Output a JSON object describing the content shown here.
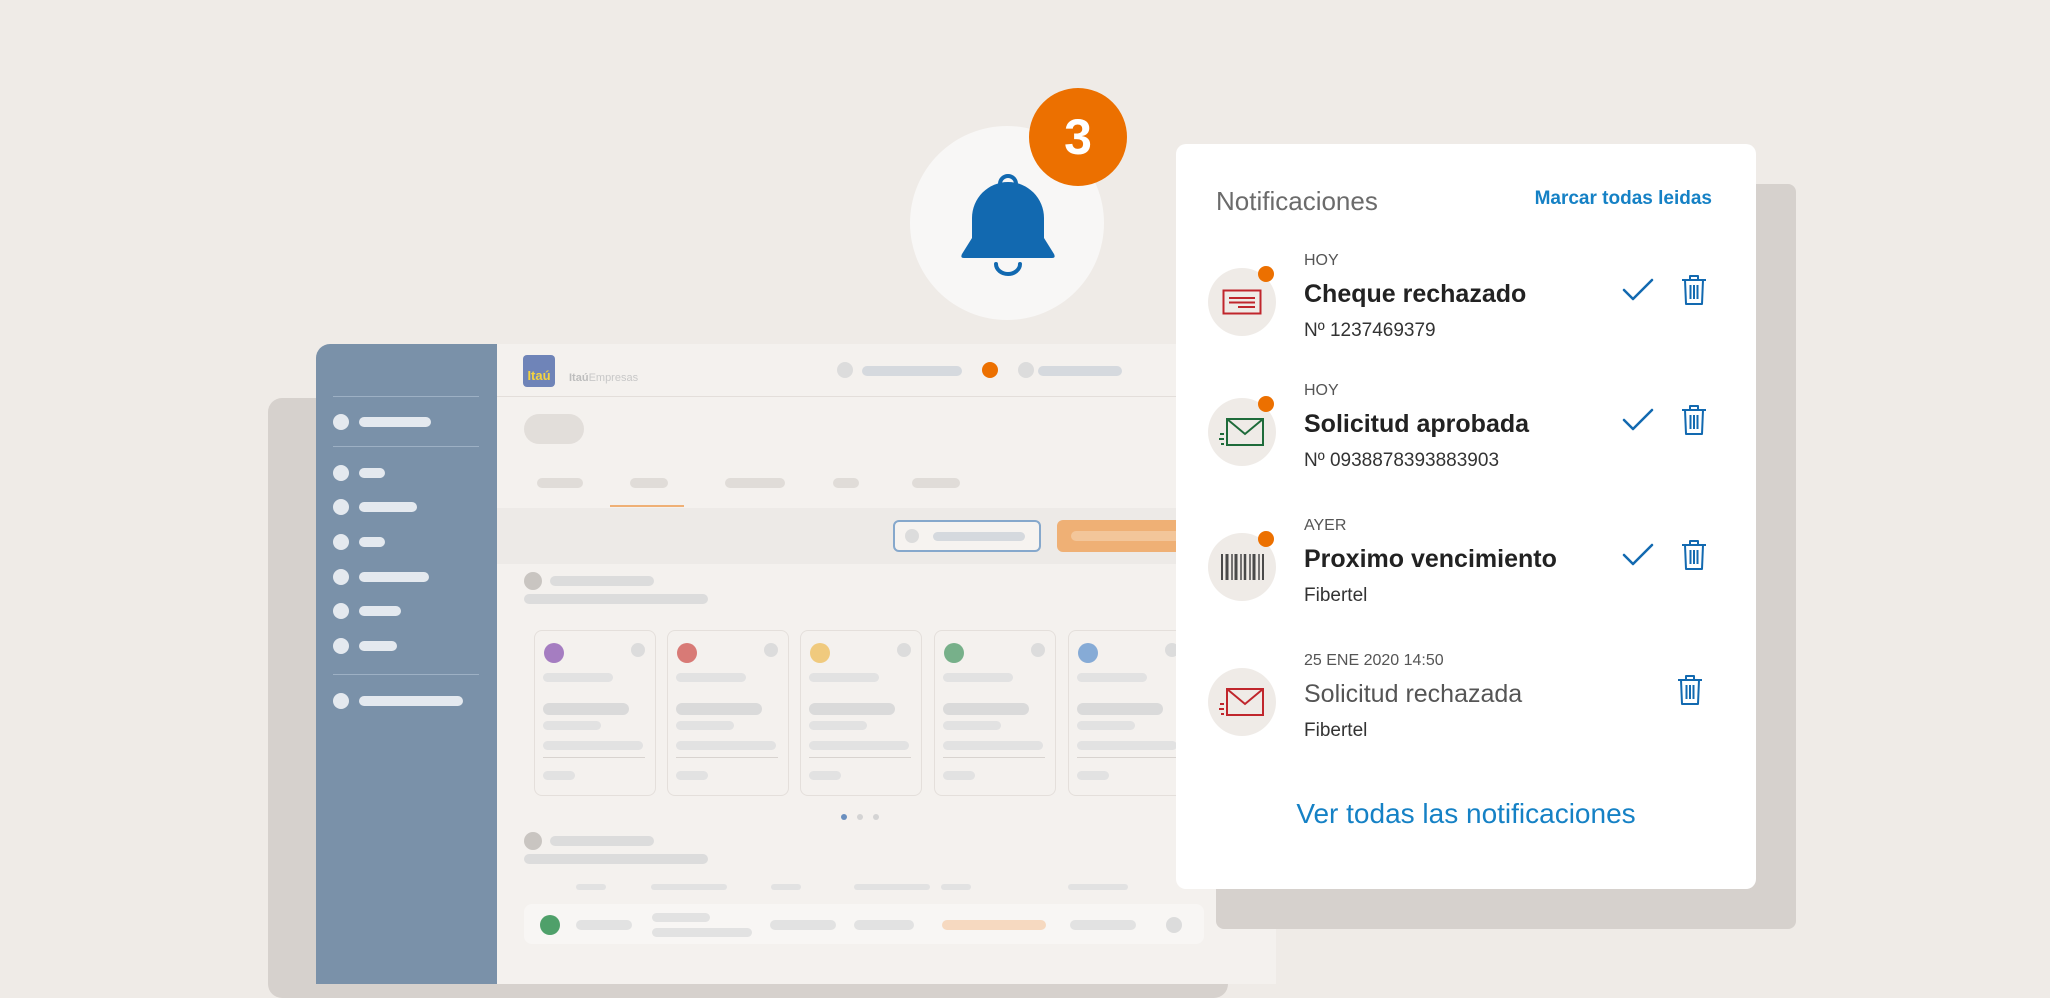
{
  "bell": {
    "badge_count": "3",
    "icon": "bell-icon"
  },
  "app": {
    "logo": "Itaú",
    "brand_bold": "Itaú",
    "brand_light": "Empresas"
  },
  "panel": {
    "title": "Notificaciones",
    "mark_all_read": "Marcar todas leidas",
    "see_all": "Ver todas las notificaciones",
    "items": [
      {
        "date": "HOY",
        "title": "Cheque rechazado",
        "subtitle": "Nº 1237469379",
        "icon": "cheque-icon",
        "unread": true,
        "color": "#C0262C"
      },
      {
        "date": "HOY",
        "title": "Solicitud aprobada",
        "subtitle": "Nº 0938878393883903",
        "icon": "envelope-icon",
        "unread": true,
        "color": "#1E6B3A"
      },
      {
        "date": "AYER",
        "title": "Proximo vencimiento",
        "subtitle": "Fibertel",
        "icon": "barcode-icon",
        "unread": true,
        "color": "#4A4A4A"
      },
      {
        "date": "25 ENE 2020 14:50",
        "title": "Solicitud rechazada",
        "subtitle": "Fibertel",
        "icon": "envelope-icon",
        "unread": false,
        "color": "#C0262C"
      }
    ]
  },
  "colors": {
    "accent": "#EC7000",
    "link": "#1581C5",
    "bell": "#1269B0",
    "sidebar": "#7A91A9"
  }
}
